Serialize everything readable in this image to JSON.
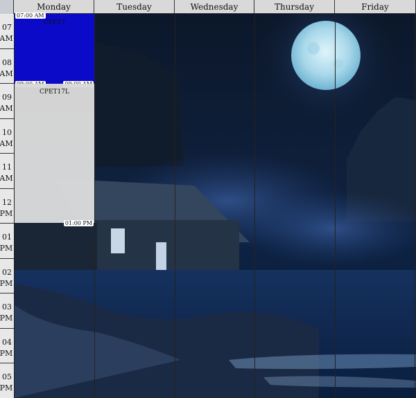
{
  "days": [
    "Monday",
    "Tuesday",
    "Wednesday",
    "Thursday",
    "Friday"
  ],
  "times": [
    {
      "hour": "07",
      "ampm": "AM"
    },
    {
      "hour": "08",
      "ampm": "AM"
    },
    {
      "hour": "09",
      "ampm": "AM"
    },
    {
      "hour": "10",
      "ampm": "AM"
    },
    {
      "hour": "11",
      "ampm": "AM"
    },
    {
      "hour": "12",
      "ampm": "PM"
    },
    {
      "hour": "01",
      "ampm": "PM"
    },
    {
      "hour": "02",
      "ampm": "PM"
    },
    {
      "hour": "03",
      "ampm": "PM"
    },
    {
      "hour": "04",
      "ampm": "PM"
    },
    {
      "hour": "05",
      "ampm": "PM"
    }
  ],
  "events": [
    {
      "title": "CPET7",
      "start_label": "07:00 AM",
      "end_label": "09:00 AM",
      "end_label_right": "09:00 AM",
      "color": "#0a0ac8"
    },
    {
      "title": "CPET17L",
      "start_label": "",
      "end_label_right": "01:00 PM",
      "color": "#cfcfcf"
    }
  ],
  "colors": {
    "header": "#d9d9d9",
    "timecol": "#e8e8e8",
    "night_sky": "#0b1628",
    "moon": "#bfe4f2"
  }
}
